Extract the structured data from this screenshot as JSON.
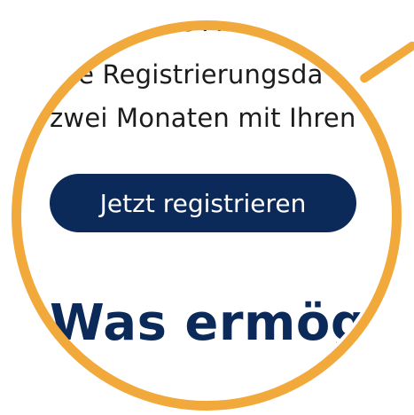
{
  "content": {
    "line1": "egebene Adr",
    "line2": "hre Registrierungsda",
    "line3": "zwei Monaten mit Ihren",
    "register_button_label": "Jetzt registrieren",
    "section_heading": "Was ermöglich"
  },
  "colors": {
    "lens_ring": "#f2a93b",
    "button_bg": "#0b2a5a",
    "heading": "#0b2a5a",
    "body_text": "#1c1c1c"
  }
}
